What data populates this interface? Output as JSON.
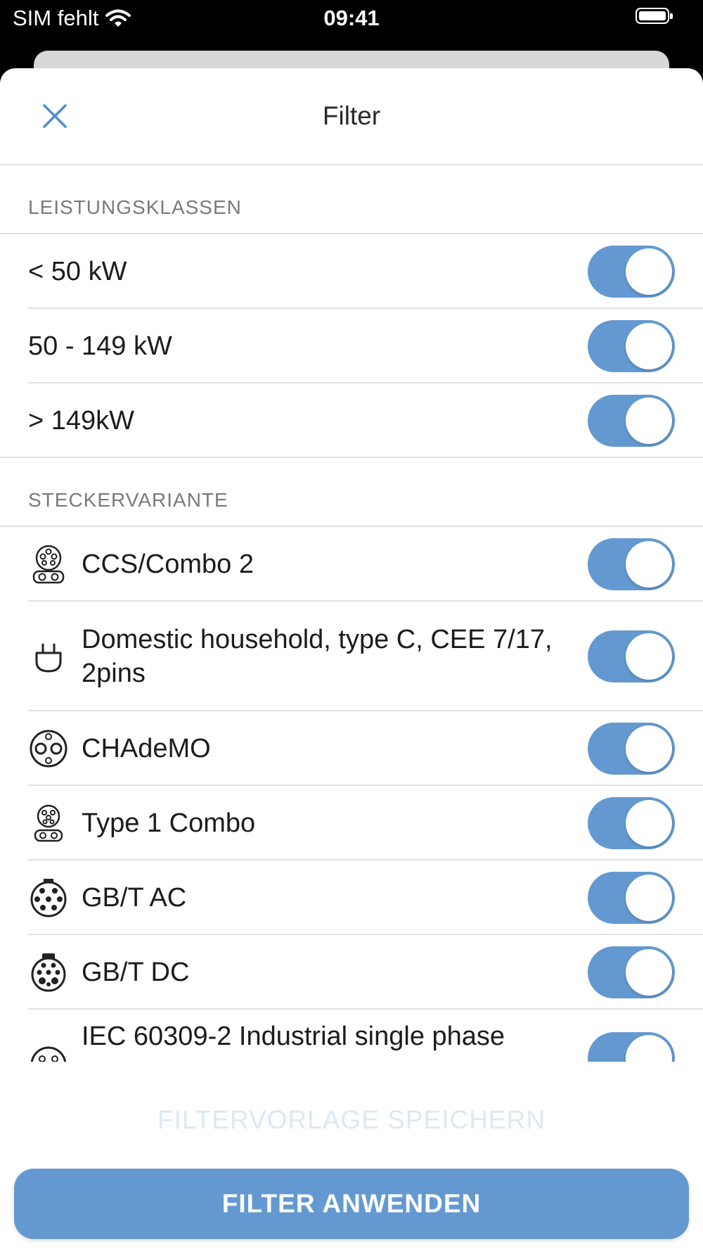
{
  "status_bar": {
    "carrier": "SIM fehlt",
    "time": "09:41"
  },
  "header": {
    "title": "Filter"
  },
  "sections": {
    "power": {
      "title": "LEISTUNGSKLASSEN",
      "items": [
        {
          "label": "< 50 kW",
          "enabled": true
        },
        {
          "label": "50 - 149 kW",
          "enabled": true
        },
        {
          "label": "> 149kW",
          "enabled": true
        }
      ]
    },
    "plugs": {
      "title": "STECKERVARIANTE",
      "items": [
        {
          "label": "CCS/Combo 2",
          "icon": "ccs-combo-2-icon",
          "enabled": true
        },
        {
          "label": "Domestic household, type C, CEE 7/17, 2pins",
          "icon": "domestic-plug-icon",
          "enabled": true
        },
        {
          "label": "CHAdeMO",
          "icon": "chademo-icon",
          "enabled": true
        },
        {
          "label": "Type 1 Combo",
          "icon": "type-1-combo-icon",
          "enabled": true
        },
        {
          "label": "GB/T AC",
          "icon": "gbt-ac-icon",
          "enabled": true
        },
        {
          "label": "GB/T DC",
          "icon": "gbt-dc-icon",
          "enabled": true
        },
        {
          "label": "IEC 60309-2 Industrial single phase",
          "icon": "iec-60309-icon",
          "enabled": true
        }
      ]
    }
  },
  "footer": {
    "save_template": "FILTERVORLAGE SPEICHERN",
    "apply": "FILTER ANWENDEN"
  },
  "colors": {
    "accent": "#6399d0",
    "close_icon": "#4f8ed0",
    "divider": "#e1e1e1"
  }
}
